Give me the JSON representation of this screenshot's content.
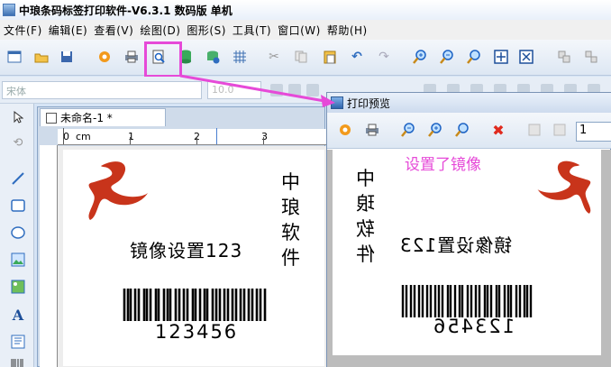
{
  "window": {
    "title": "中琅条码标签打印软件-V6.3.1 数码版 单机"
  },
  "menu": [
    "文件(F)",
    "编辑(E)",
    "查看(V)",
    "绘图(D)",
    "图形(S)",
    "工具(T)",
    "窗口(W)",
    "帮助(H)"
  ],
  "toolbar": {
    "icons": [
      "new-icon",
      "open-icon",
      "save-icon",
      "settings-icon",
      "print-icon",
      "print-preview-icon",
      "database-icon",
      "data-source-icon",
      "grid-icon",
      "cut-icon",
      "copy-icon",
      "paste-icon",
      "undo-icon",
      "redo-icon",
      "zoom-in-icon",
      "zoom-out-icon",
      "zoom-actual-icon",
      "fit-page-icon",
      "fit-width-icon",
      "group-icon",
      "ungroup-icon"
    ]
  },
  "format_bar": {
    "font_value": "宋体",
    "size_value": "10.0"
  },
  "document": {
    "tab_label": "未命名-1 *",
    "ruler": [
      "0",
      "cm",
      "1",
      "2",
      "3"
    ],
    "label": {
      "vertical_text": [
        "中",
        "琅",
        "软",
        "件"
      ],
      "text": "镜像设置123",
      "barcode_number": "123456"
    }
  },
  "preview": {
    "title": "打印预览",
    "page_value": "1",
    "annotation": "设置了镜像",
    "label": {
      "vertical_text": [
        "中",
        "琅",
        "软",
        "件"
      ],
      "text": "镜像设置123",
      "barcode_number": "123456"
    }
  },
  "colors": {
    "accent": "#e64ad8",
    "logo": "#c8341b",
    "annotation": "#e64ad8"
  }
}
